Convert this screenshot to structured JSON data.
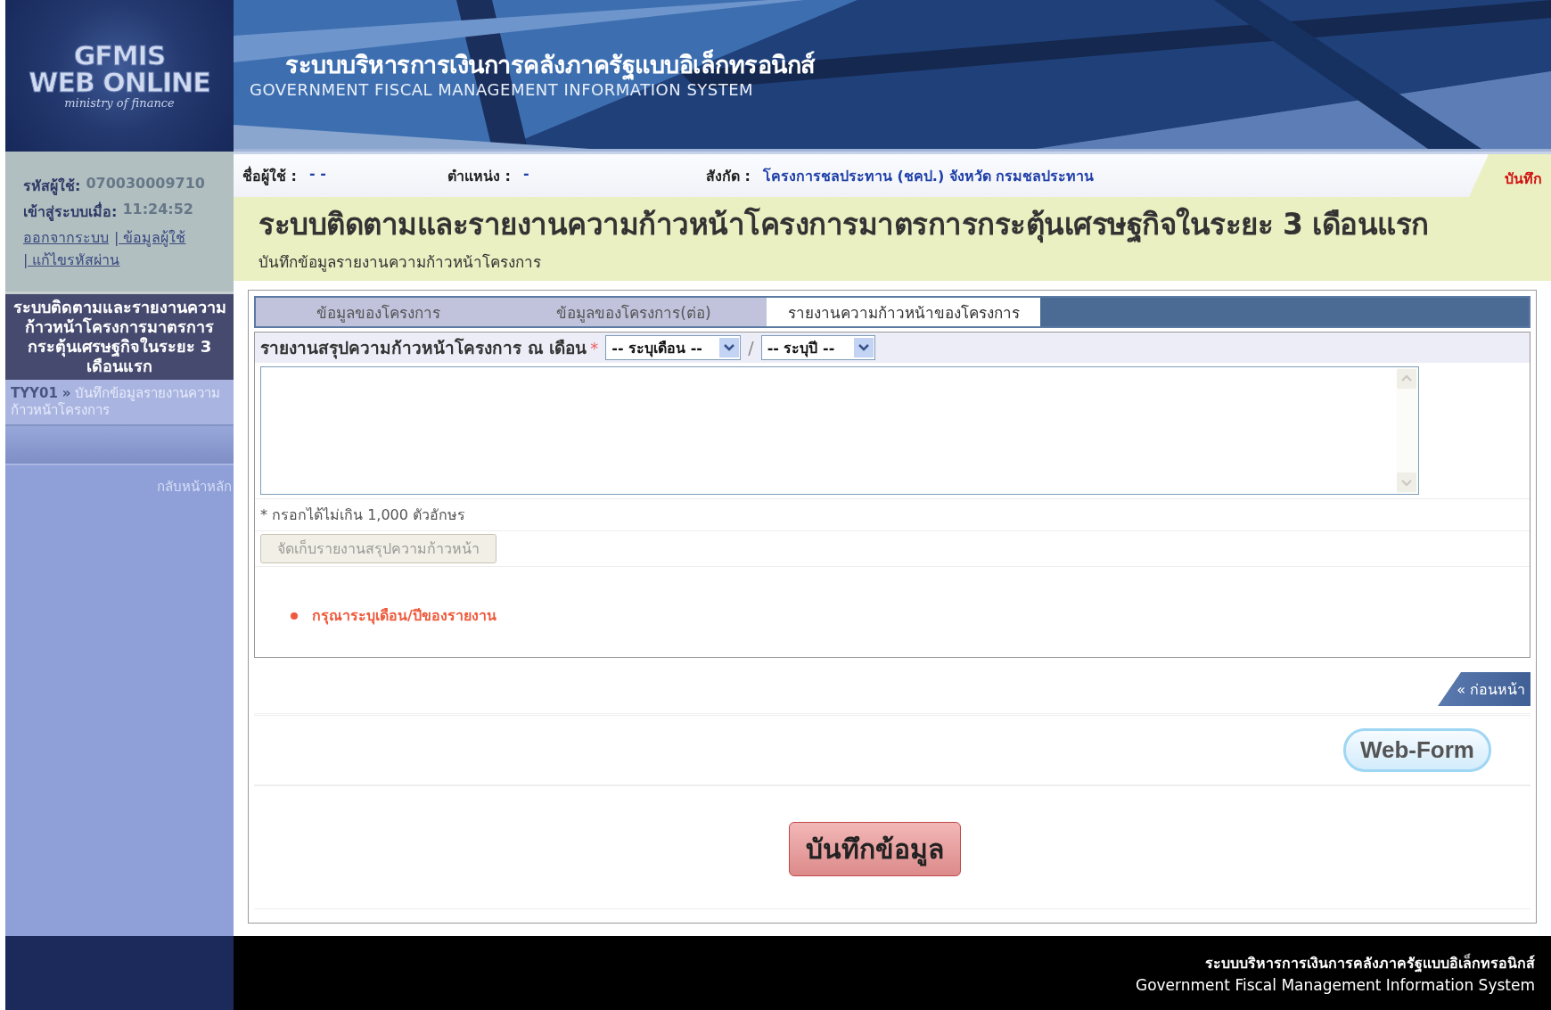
{
  "logo": {
    "line1": "GFMIS",
    "line2": "WEB ONLINE",
    "line3": "ministry of finance"
  },
  "banner": {
    "title_th": "ระบบบริหารการเงินการคลังภาครัฐแบบอิเล็กทรอนิกส์",
    "title_en": "GOVERNMENT FISCAL MANAGEMENT INFORMATION SYSTEM"
  },
  "user_panel": {
    "user_id_label": "รหัสผู้ใช้:",
    "user_id": "070030009710",
    "login_label": "เข้าสู่ระบบเมื่อ:",
    "login_time": "11:24:52",
    "links": [
      "ออกจากระบบ",
      "| ข้อมูลผู้ใช้",
      "| แก้ไขรหัสผ่าน"
    ]
  },
  "sidebar": {
    "menu_title": "ระบบติดตามและรายงานความก้าวหน้าโครงการมาตรการกระตุ้นเศรษฐกิจในระยะ 3 เดือนแรก",
    "breadcrumb": {
      "code": "TYY01",
      "separator": "»",
      "text": "บันทึกข้อมูลรายงานความก้าวหน้าโครงการ"
    },
    "back_link": "กลับหน้าหลัก"
  },
  "info_bar": {
    "fields": [
      {
        "label": "ชื่อผู้ใช้ :",
        "value": "- -"
      },
      {
        "label": "ตำแหน่ง :",
        "value": "-"
      },
      {
        "label": "สังกัด :",
        "value": "โครงการชลประทาน (ชคป.) จังหวัด กรมชลประทาน"
      }
    ],
    "mode_badge": "บันทึก"
  },
  "page_title": "ระบบติดตามและรายงานความก้าวหน้าโครงการมาตรการกระตุ้นเศรษฐกิจในระยะ 3 เดือนแรก",
  "page_subtitle": "บันทึกข้อมูลรายงานความก้าวหน้าโครงการ",
  "tabs": [
    {
      "label": "ข้อมูลของโครงการ",
      "selected": false
    },
    {
      "label": "ข้อมูลของโครงการ(ต่อ)",
      "selected": false
    },
    {
      "label": "รายงานความก้าวหน้าของโครงการ",
      "selected": true
    }
  ],
  "form": {
    "label": "รายงานสรุปความก้าวหน้าโครงการ ณ เดือน",
    "required_mark": "*",
    "month_select": {
      "value": "-- ระบุเดือน --"
    },
    "separator": "/",
    "year_select": {
      "value": "-- ระบุปี --"
    },
    "hint": "* กรอกได้ไม่เกิน 1,000 ตัวอักษร",
    "store_button": {
      "label": "จัดเก็บรายงานสรุปความก้าวหน้า",
      "disabled": true
    },
    "errors": [
      "กรุณาระบุเดือน/ปีของรายงาน"
    ]
  },
  "prev_button": "« ก่อนหน้า",
  "web_form_button": "Web-Form",
  "save_button": "บันทึกข้อมูล",
  "footer": {
    "line_th": "ระบบบริหารการเงินการคลังภาครัฐแบบอิเล็กทรอนิกส์",
    "line_en": "Government Fiscal Management Information System"
  }
}
